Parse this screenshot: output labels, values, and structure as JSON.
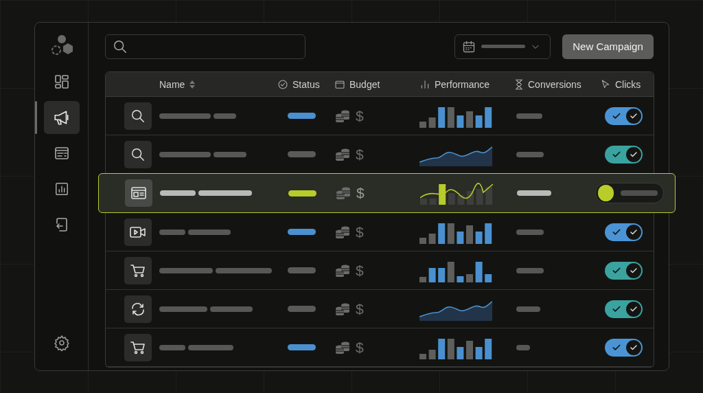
{
  "sidebar": {
    "items": [
      {
        "selected": false
      },
      {
        "selected": true
      },
      {
        "selected": false
      },
      {
        "selected": false
      },
      {
        "selected": false
      }
    ]
  },
  "toolbar": {
    "new_button": "New Campaign"
  },
  "table": {
    "columns": [
      {
        "label": "Name",
        "sortable": true
      },
      {
        "label": "Status",
        "sortable": false
      },
      {
        "label": "Budget",
        "sortable": false
      },
      {
        "label": "Performance",
        "sortable": false
      },
      {
        "label": "Conversions",
        "sortable": false
      },
      {
        "label": "Clicks",
        "sortable": false
      }
    ],
    "rows": [
      {
        "selected": false,
        "status": {
          "color": "#4a90d0"
        },
        "budget_symbol": "$",
        "performance": {
          "kind": "bars"
        },
        "toggle": {
          "on": true,
          "color": "#4a94d6"
        }
      },
      {
        "selected": false,
        "status": {
          "color": "#5a5b59"
        },
        "budget_symbol": "$",
        "performance": {
          "kind": "area"
        },
        "toggle": {
          "on": true,
          "color": "#3aa3a0"
        }
      },
      {
        "selected": true,
        "status": {
          "color": "#b8cc2a"
        },
        "budget_symbol": "$",
        "performance": {
          "kind": "barsline"
        },
        "toggle": {
          "on": false,
          "color": "#b8cc2a"
        }
      },
      {
        "selected": false,
        "status": {
          "color": "#4a90d0"
        },
        "budget_symbol": "$",
        "performance": {
          "kind": "bars"
        },
        "toggle": {
          "on": true,
          "color": "#4a94d6"
        }
      },
      {
        "selected": false,
        "status": {
          "color": "#5a5b59"
        },
        "budget_symbol": "$",
        "performance": {
          "kind": "bars"
        },
        "toggle": {
          "on": true,
          "color": "#3aa3a0"
        }
      },
      {
        "selected": false,
        "status": {
          "color": "#5a5b59"
        },
        "budget_symbol": "$",
        "performance": {
          "kind": "area"
        },
        "toggle": {
          "on": true,
          "color": "#3aa3a0"
        }
      },
      {
        "selected": false,
        "status": {
          "color": "#4a90d0"
        },
        "budget_symbol": "$",
        "performance": {
          "kind": "bars"
        },
        "toggle": {
          "on": true,
          "color": "#4a94d6"
        }
      }
    ]
  }
}
